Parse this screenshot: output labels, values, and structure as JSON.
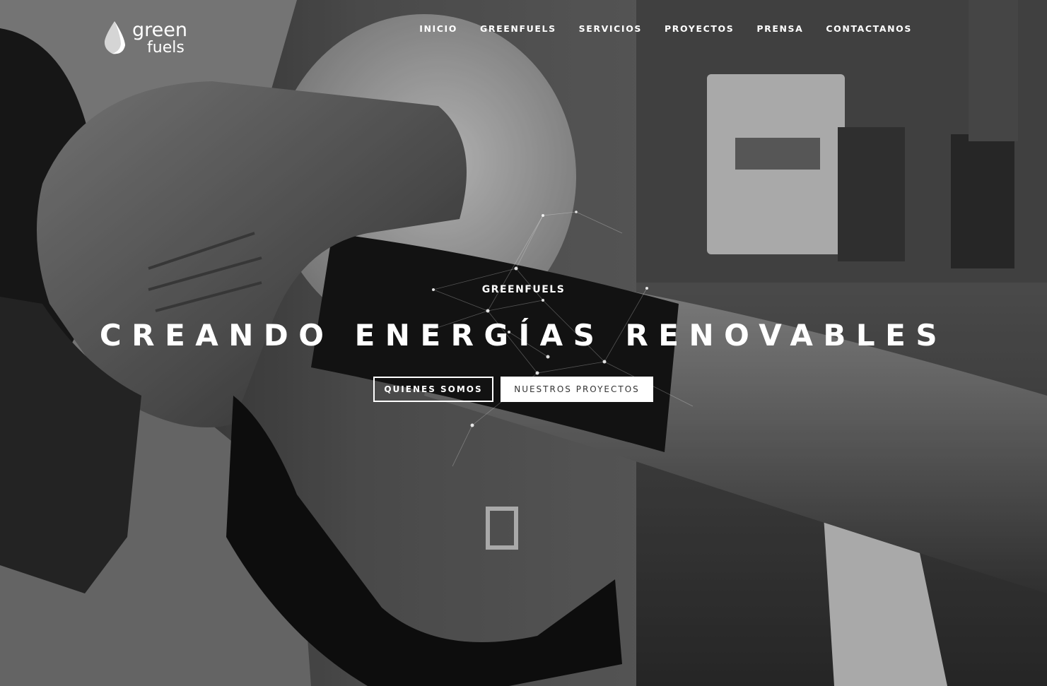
{
  "brand": {
    "logo_word_top": "green",
    "logo_word_bottom": "fuels"
  },
  "nav": {
    "items": [
      {
        "label": "INICIO"
      },
      {
        "label": "GREENFUELS"
      },
      {
        "label": "SERVICIOS"
      },
      {
        "label": "PROYECTOS"
      },
      {
        "label": "PRENSA"
      },
      {
        "label": "CONTACTANOS"
      }
    ]
  },
  "hero": {
    "eyebrow": "GREENFUELS",
    "headline": "CREANDO ENERGÍAS RENOVABLES",
    "primary_button": "QUIENES SOMOS",
    "secondary_button": "NUESTROS PROYECTOS",
    "background_icon": "fuel-nozzle-photo"
  },
  "colors": {
    "text": "#ffffff",
    "button_solid_bg": "#ffffff",
    "button_solid_text": "#333333"
  }
}
